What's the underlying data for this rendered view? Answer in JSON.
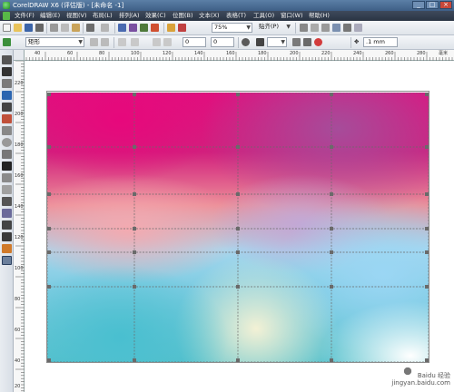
{
  "window": {
    "title": "CorelDRAW X6 (评估版) - [未命名 -1]",
    "buttons": [
      "_",
      "□",
      "×"
    ]
  },
  "menu": {
    "items": [
      "文件(F)",
      "编辑(E)",
      "视图(V)",
      "布局(L)",
      "排列(A)",
      "效果(C)",
      "位图(B)",
      "文本(X)",
      "表格(T)",
      "工具(O)",
      "窗口(W)",
      "帮助(H)"
    ]
  },
  "toolbar_standard": {
    "zoom": "75%",
    "snap": "贴齐(P)"
  },
  "property_bar": {
    "preset": "矩形",
    "spinner_a": "0",
    "spinner_b": "0",
    "nudge": ".1 mm"
  },
  "ruler_h": {
    "labels": [
      "40",
      "60",
      "80",
      "100",
      "120",
      "140",
      "160",
      "180",
      "200",
      "220",
      "240",
      "260",
      "280"
    ],
    "unit": "毫米"
  },
  "ruler_v": {
    "labels": [
      "220",
      "200",
      "180",
      "160",
      "140",
      "120",
      "100",
      "80",
      "60",
      "40",
      "20"
    ]
  },
  "watermark": {
    "line1": "Baidu 经验",
    "line2": "jingyan.baidu.com"
  },
  "colors": {
    "magenta": "#e10f7e",
    "pink": "#ec8e98",
    "light_blue": "#a8d7ee",
    "teal": "#56c1cc",
    "title_bar": "#3e5f86",
    "menu_bar": "#2a3443"
  }
}
